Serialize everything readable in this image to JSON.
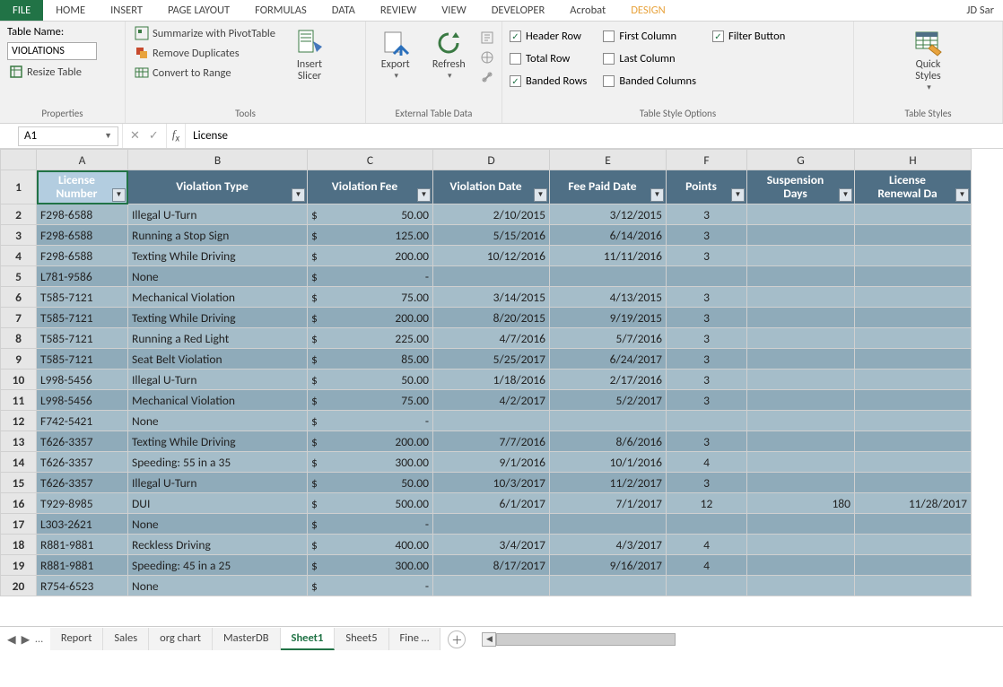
{
  "ribbonTabs": [
    "FILE",
    "HOME",
    "INSERT",
    "PAGE LAYOUT",
    "FORMULAS",
    "DATA",
    "REVIEW",
    "VIEW",
    "DEVELOPER",
    "Acrobat",
    "DESIGN"
  ],
  "userName": "JD Sar",
  "properties": {
    "tableNameLabel": "Table Name:",
    "tableNameValue": "VIOLATIONS",
    "resize": "Resize Table",
    "groupLabel": "Properties"
  },
  "tools": {
    "pivot": "Summarize with PivotTable",
    "dupes": "Remove Duplicates",
    "range": "Convert to Range",
    "slicer": "Insert Slicer",
    "groupLabel": "Tools"
  },
  "ext": {
    "export": "Export",
    "refresh": "Refresh",
    "groupLabel": "External Table Data"
  },
  "styleOpts": {
    "headerRow": "Header Row",
    "totalRow": "Total Row",
    "bandedRows": "Banded Rows",
    "firstCol": "First Column",
    "lastCol": "Last Column",
    "bandedCols": "Banded Columns",
    "filterBtn": "Filter Button",
    "groupLabel": "Table Style Options"
  },
  "quick": {
    "label": "Quick Styles",
    "groupLabel": "Table Styles"
  },
  "fbar": {
    "ref": "A1",
    "value": "License"
  },
  "columns": [
    "A",
    "B",
    "C",
    "D",
    "E",
    "F",
    "G",
    "H"
  ],
  "headers": {
    "A": "License Number",
    "B": "Violation Type",
    "C": "Violation Fee",
    "D": "Violation Date",
    "E": "Fee Paid Date",
    "F": "Points",
    "G": "Suspension Days",
    "H": "License Renewal Da"
  },
  "rows": [
    {
      "n": 2,
      "A": "F298-6588",
      "B": "Illegal U-Turn",
      "C": "50.00",
      "D": "2/10/2015",
      "E": "3/12/2015",
      "F": "3",
      "G": "",
      "H": ""
    },
    {
      "n": 3,
      "A": "F298-6588",
      "B": "Running a Stop Sign",
      "C": "125.00",
      "D": "5/15/2016",
      "E": "6/14/2016",
      "F": "3",
      "G": "",
      "H": ""
    },
    {
      "n": 4,
      "A": "F298-6588",
      "B": "Texting While Driving",
      "C": "200.00",
      "D": "10/12/2016",
      "E": "11/11/2016",
      "F": "3",
      "G": "",
      "H": ""
    },
    {
      "n": 5,
      "A": "L781-9586",
      "B": "None",
      "C": "-",
      "D": "",
      "E": "",
      "F": "",
      "G": "",
      "H": ""
    },
    {
      "n": 6,
      "A": "T585-7121",
      "B": "Mechanical Violation",
      "C": "75.00",
      "D": "3/14/2015",
      "E": "4/13/2015",
      "F": "3",
      "G": "",
      "H": ""
    },
    {
      "n": 7,
      "A": "T585-7121",
      "B": "Texting While Driving",
      "C": "200.00",
      "D": "8/20/2015",
      "E": "9/19/2015",
      "F": "3",
      "G": "",
      "H": ""
    },
    {
      "n": 8,
      "A": "T585-7121",
      "B": "Running a Red Light",
      "C": "225.00",
      "D": "4/7/2016",
      "E": "5/7/2016",
      "F": "3",
      "G": "",
      "H": ""
    },
    {
      "n": 9,
      "A": "T585-7121",
      "B": "Seat Belt Violation",
      "C": "85.00",
      "D": "5/25/2017",
      "E": "6/24/2017",
      "F": "3",
      "G": "",
      "H": ""
    },
    {
      "n": 10,
      "A": "L998-5456",
      "B": "Illegal U-Turn",
      "C": "50.00",
      "D": "1/18/2016",
      "E": "2/17/2016",
      "F": "3",
      "G": "",
      "H": ""
    },
    {
      "n": 11,
      "A": "L998-5456",
      "B": "Mechanical Violation",
      "C": "75.00",
      "D": "4/2/2017",
      "E": "5/2/2017",
      "F": "3",
      "G": "",
      "H": ""
    },
    {
      "n": 12,
      "A": "F742-5421",
      "B": "None",
      "C": "-",
      "D": "",
      "E": "",
      "F": "",
      "G": "",
      "H": ""
    },
    {
      "n": 13,
      "A": "T626-3357",
      "B": "Texting While Driving",
      "C": "200.00",
      "D": "7/7/2016",
      "E": "8/6/2016",
      "F": "3",
      "G": "",
      "H": ""
    },
    {
      "n": 14,
      "A": "T626-3357",
      "B": "Speeding: 55 in a 35",
      "C": "300.00",
      "D": "9/1/2016",
      "E": "10/1/2016",
      "F": "4",
      "G": "",
      "H": ""
    },
    {
      "n": 15,
      "A": "T626-3357",
      "B": "Illegal U-Turn",
      "C": "50.00",
      "D": "10/3/2017",
      "E": "11/2/2017",
      "F": "3",
      "G": "",
      "H": ""
    },
    {
      "n": 16,
      "A": "T929-8985",
      "B": "DUI",
      "C": "500.00",
      "D": "6/1/2017",
      "E": "7/1/2017",
      "F": "12",
      "G": "180",
      "H": "11/28/2017"
    },
    {
      "n": 17,
      "A": "L303-2621",
      "B": "None",
      "C": "-",
      "D": "",
      "E": "",
      "F": "",
      "G": "",
      "H": ""
    },
    {
      "n": 18,
      "A": "R881-9881",
      "B": "Reckless Driving",
      "C": "400.00",
      "D": "3/4/2017",
      "E": "4/3/2017",
      "F": "4",
      "G": "",
      "H": ""
    },
    {
      "n": 19,
      "A": "R881-9881",
      "B": "Speeding: 45 in a 25",
      "C": "300.00",
      "D": "8/17/2017",
      "E": "9/16/2017",
      "F": "4",
      "G": "",
      "H": ""
    },
    {
      "n": 20,
      "A": "R754-6523",
      "B": "None",
      "C": "-",
      "D": "",
      "E": "",
      "F": "",
      "G": "",
      "H": ""
    }
  ],
  "sheets": [
    "Report",
    "Sales",
    "org chart",
    "MasterDB",
    "Sheet1",
    "Sheet5",
    "Fine …"
  ],
  "activeSheet": "Sheet1",
  "ellipsis": "…"
}
